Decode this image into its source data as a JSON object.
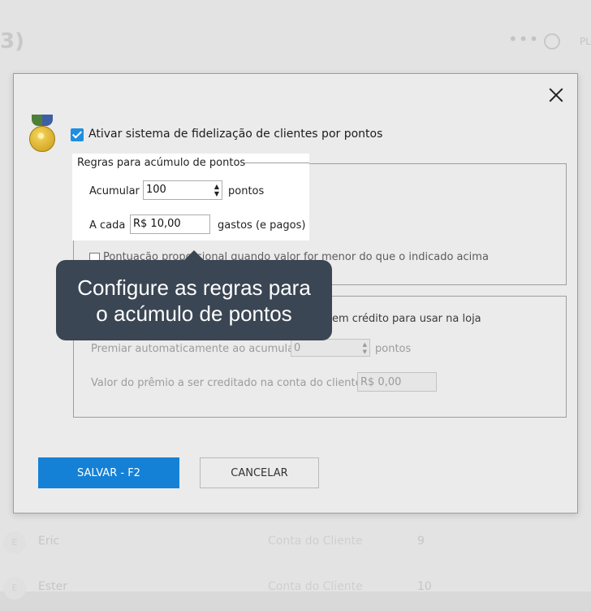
{
  "background": {
    "title": "3)",
    "dots": "•••",
    "plus": "PL",
    "rows": [
      {
        "avatar": "E",
        "name": "Eric",
        "account": "Conta do Cliente",
        "points": "9"
      },
      {
        "avatar": "E",
        "name": "Ester",
        "account": "Conta do Cliente",
        "points": "10"
      }
    ]
  },
  "dialog": {
    "enable_label": "Ativar sistema de fidelização de clientes por pontos",
    "accumulation": {
      "legend": "Regras para acúmulo de pontos",
      "accumulate_label": "Acumular",
      "accumulate_value": "100",
      "points_unit": "pontos",
      "each_label": "A cada",
      "each_value": "R$ 10,00",
      "each_unit": "gastos (e pagos)",
      "proportional_label": "Pontuação proporcional quando valor for menor do que o indicado acima"
    },
    "reward": {
      "convert_label": "em crédito para usar na loja",
      "auto_label": "Premiar automaticamente ao acumular",
      "auto_value": "0",
      "auto_unit": "pontos",
      "value_label": "Valor do prêmio a ser creditado na conta do cliente",
      "value_value": "R$ 0,00"
    },
    "save_label": "SALVAR - F2",
    "cancel_label": "CANCELAR"
  },
  "tooltip": {
    "line1": "Configure as regras para",
    "line2": "o acúmulo de pontos"
  }
}
